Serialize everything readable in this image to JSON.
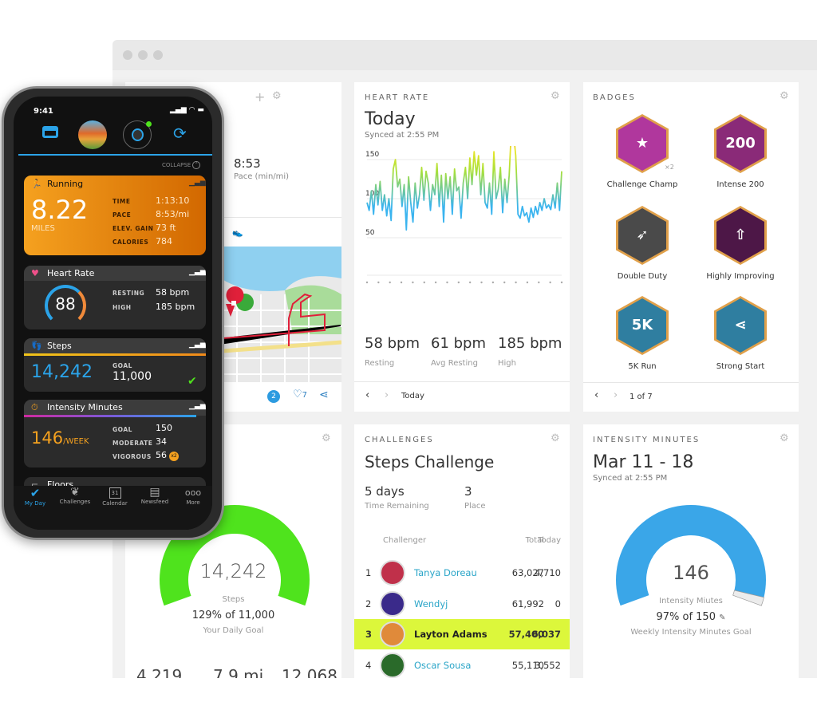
{
  "activity": {
    "pace_value": "8:53",
    "pace_label": "Pace (min/mi)",
    "comments": "2",
    "likes": "7"
  },
  "heart_rate": {
    "caption": "HEART RATE",
    "title": "Today",
    "synced": "Synced at 2:55 PM",
    "stats": [
      {
        "value": "58 bpm",
        "label": "Resting"
      },
      {
        "value": "61 bpm",
        "label": "Avg Resting"
      },
      {
        "value": "185 bpm",
        "label": "High"
      }
    ],
    "nav_label": "Today"
  },
  "chart_data": {
    "type": "line",
    "title": "",
    "xlabel": "",
    "ylabel": "",
    "yticks": [
      50,
      100,
      150,
      200
    ],
    "ylim": [
      0,
      200
    ],
    "grid": true,
    "values": [
      95,
      85,
      110,
      80,
      118,
      92,
      122,
      85,
      105,
      78,
      100,
      72,
      138,
      150,
      115,
      125,
      90,
      118,
      60,
      128,
      95,
      70,
      120,
      88,
      105,
      140,
      98,
      135,
      120,
      85,
      118,
      105,
      145,
      90,
      130,
      70,
      132,
      100,
      128,
      80,
      138,
      110,
      115,
      75,
      120,
      140,
      100,
      152,
      118,
      160,
      130,
      155,
      105,
      145,
      95,
      88,
      120,
      80,
      160,
      100,
      112,
      140,
      82,
      125,
      95,
      130,
      188,
      183,
      155,
      80,
      75,
      90,
      78,
      82,
      70,
      88,
      76,
      90,
      80,
      95,
      85,
      100,
      88,
      92,
      86,
      105,
      88,
      120,
      85,
      135
    ],
    "colors": {
      "low": "#3ab4ef",
      "mid": "#a8e03a",
      "high": "#e9e52a",
      "peak": "#e8862a"
    }
  },
  "badges": {
    "caption": "BADGES",
    "page": "1 of 7",
    "items": [
      {
        "label": "Challenge Champ",
        "count": "×2",
        "color": "#b0379d",
        "glyph": "★"
      },
      {
        "label": "Intense 200",
        "count": "",
        "color": "#8a2a78",
        "glyph": "200"
      },
      {
        "label": "Double Duty",
        "count": "",
        "color": "#4a4a4a",
        "glyph": "➶"
      },
      {
        "label": "Highly Improving",
        "count": "",
        "color": "#4d1747",
        "glyph": "⇧"
      },
      {
        "label": "5K Run",
        "count": "",
        "color": "#2f7ea0",
        "glyph": "5K"
      },
      {
        "label": "Strong Start",
        "count": "",
        "color": "#2f7ea0",
        "glyph": "⋖"
      }
    ]
  },
  "steps_card": {
    "value": "14,242",
    "label": "Steps",
    "percent_text": "129% of 11,000",
    "goal_label": "Your Daily Goal",
    "progress": 1.29,
    "color": "#4fe31d",
    "bottom_stats": [
      "4,219",
      "7.9 mi",
      "12,068"
    ]
  },
  "challenges": {
    "caption": "CHALLENGES",
    "title": "Steps Challenge",
    "time_value": "5 days",
    "time_label": "Time Remaining",
    "place_value": "3",
    "place_label": "Place",
    "headers": {
      "challenger": "Challenger",
      "total": "Total",
      "today": "Today"
    },
    "rows": [
      {
        "rank": "1",
        "name": "Tanya Doreau",
        "total": "63,027",
        "today": "4,710",
        "highlight": false
      },
      {
        "rank": "2",
        "name": "Wendyj",
        "total": "61,992",
        "today": "0",
        "highlight": false
      },
      {
        "rank": "3",
        "name": "Layton Adams",
        "total": "57,400",
        "today": "6,037",
        "highlight": true
      },
      {
        "rank": "4",
        "name": "Oscar Sousa",
        "total": "55,110",
        "today": "3,552",
        "highlight": false
      }
    ],
    "highlight_color": "#dcf73b",
    "link_color": "#2aa5c8"
  },
  "intensity_card": {
    "caption": "INTENSITY MINUTES",
    "title": "Mar 11 - 18",
    "synced": "Synced at 2:55 PM",
    "value": "146",
    "label": "Intensity Miutes",
    "percent_text": "97% of 150",
    "goal_label": "Weekly Intensity Minutes Goal",
    "progress": 0.97,
    "color": "#3aa6e8"
  },
  "phone": {
    "time": "9:41",
    "collapse": "COLLAPSE",
    "running": {
      "title": "Running",
      "distance": "8.22",
      "unit": "MILES",
      "rows": [
        {
          "k": "TIME",
          "v": "1:13:10"
        },
        {
          "k": "PACE",
          "v": "8:53/mi"
        },
        {
          "k": "ELEV. GAIN",
          "v": "73 ft"
        },
        {
          "k": "CALORIES",
          "v": "784"
        }
      ]
    },
    "heart": {
      "title": "Heart Rate",
      "value": "88",
      "rows": [
        {
          "k": "RESTING",
          "v": "58 bpm"
        },
        {
          "k": "HIGH",
          "v": "185 bpm"
        }
      ]
    },
    "steps": {
      "title": "Steps",
      "value": "14,242",
      "goal_label": "GOAL",
      "goal": "11,000"
    },
    "intensity": {
      "title": "Intensity Minutes",
      "value": "146",
      "unit": "/WEEK",
      "rows": [
        {
          "k": "GOAL",
          "v": "150"
        },
        {
          "k": "MODERATE",
          "v": "34"
        },
        {
          "k": "VIGOROUS",
          "v": "56"
        }
      ],
      "badge": "x2"
    },
    "floors": {
      "title": "Floors"
    },
    "tabs": [
      "My Day",
      "Challenges",
      "Calendar",
      "Newsfeed",
      "More"
    ],
    "calendar_day": "31"
  }
}
